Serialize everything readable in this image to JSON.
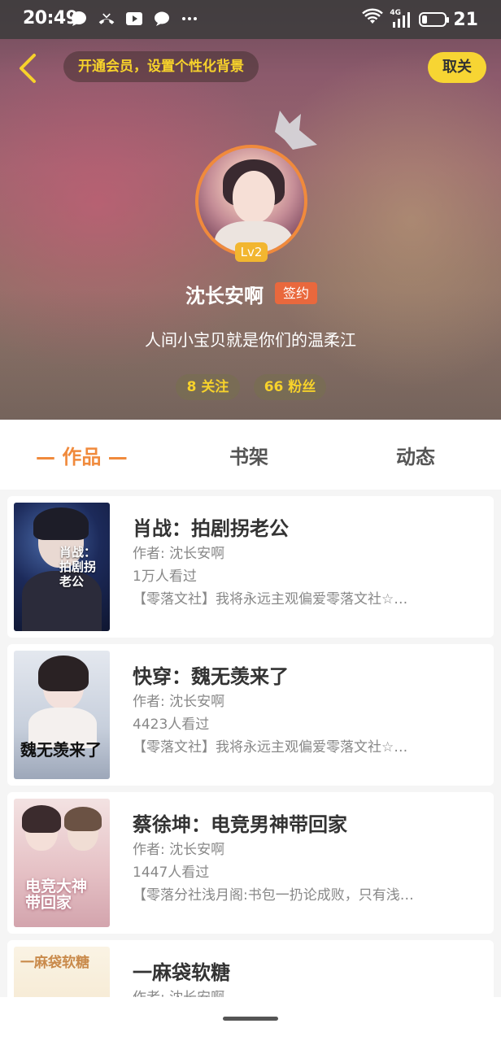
{
  "status_bar": {
    "time": "20:49",
    "network": "4G",
    "battery": "21"
  },
  "header": {
    "vip_banner": "开通会员，设置个性化背景",
    "unfollow_label": "取关"
  },
  "profile": {
    "level": "Lv2",
    "username": "沈长安啊",
    "sign_badge": "签约",
    "bio": "人间小宝贝就是你们的温柔江",
    "following": "8 关注",
    "followers": "66 粉丝"
  },
  "tabs": [
    {
      "label": "— 作品 —"
    },
    {
      "label": "书架"
    },
    {
      "label": "动态"
    }
  ],
  "books": [
    {
      "title": "肖战：拍剧拐老公",
      "cover_text": "肖战：拍剧拐老公",
      "author": "作者: 沈长安啊",
      "views": "1万人看过",
      "desc": "【零落文社】我将永远主观偏爱零落文社☆…",
      "cover_colors": [
        "#1c2a5a",
        "#0f1630"
      ]
    },
    {
      "title": "快穿：魏无羡来了",
      "cover_text": "魏无羡来了",
      "author": "作者: 沈长安啊",
      "views": "4423人看过",
      "desc": "【零落文社】我将永远主观偏爱零落文社☆…",
      "cover_colors": [
        "#dfe3ea",
        "#a9b3c4"
      ]
    },
    {
      "title": "蔡徐坤：电竞男神带回家",
      "cover_text": "电竞大神带回家",
      "author": "作者: 沈长安啊",
      "views": "1447人看过",
      "desc": "【零落分社浅月阁:书包一扔论成败，只有浅…",
      "cover_colors": [
        "#f0dcdc",
        "#d6a9b1"
      ]
    },
    {
      "title": "一麻袋软糖",
      "cover_text": "一麻袋软糖",
      "author": "作者: 沈长安啊",
      "views": "",
      "desc": "",
      "cover_colors": [
        "#f7efdd",
        "#efd9b4"
      ]
    }
  ],
  "colors": {
    "accent": "#f08a3c",
    "yellow": "#f7d533",
    "sign": "#e9683d"
  }
}
